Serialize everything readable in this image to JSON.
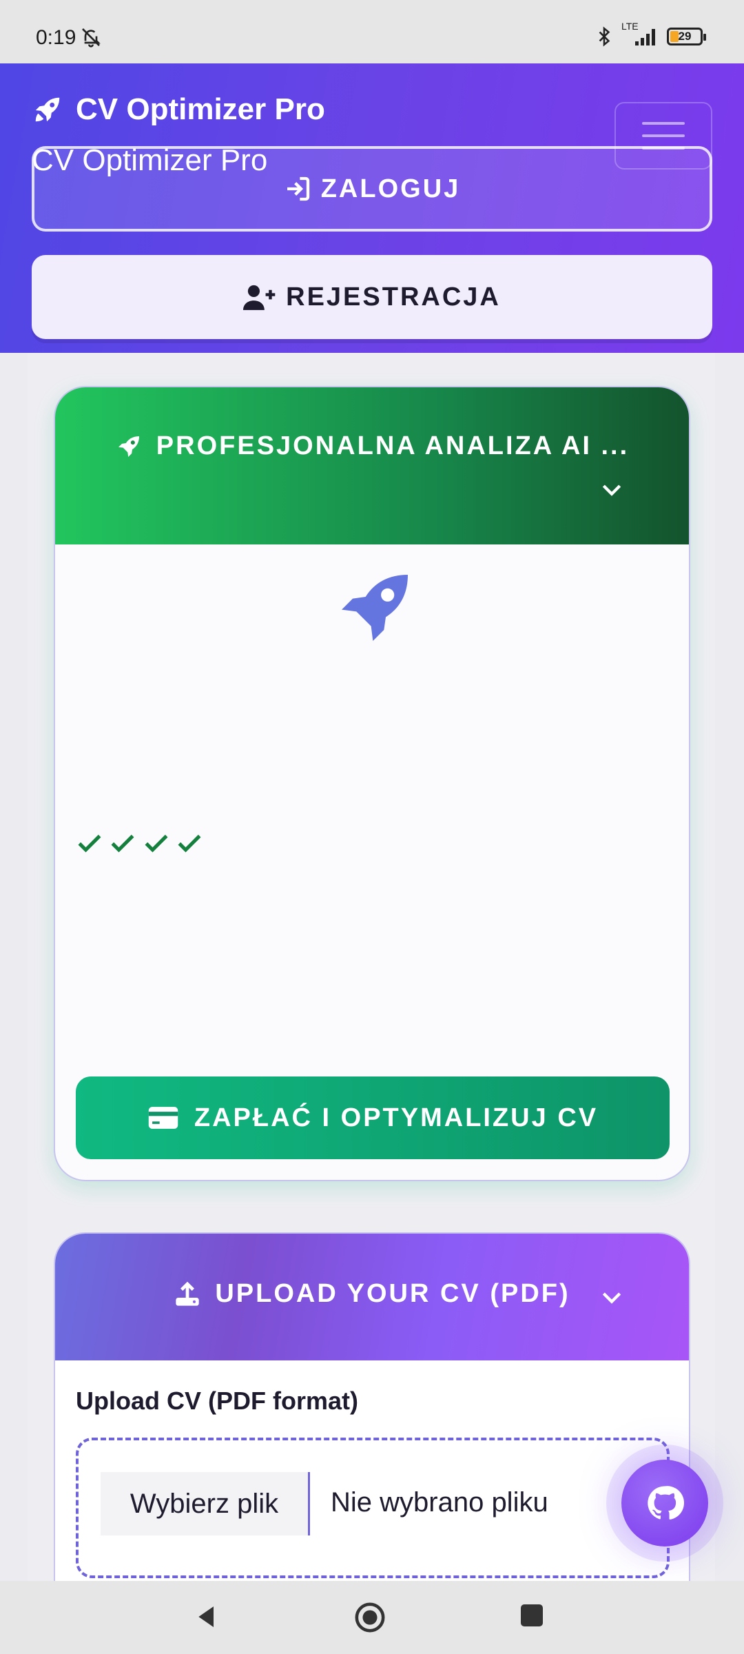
{
  "status_bar": {
    "time": "0:19",
    "network": "LTE",
    "battery": "29"
  },
  "header": {
    "brand": "CV Optimizer Pro",
    "brand_secondary": "CV Optimizer Pro",
    "login_label": "ZALOGUJ",
    "register_label": "REJESTRACJA"
  },
  "pro_card": {
    "title": "PROFESJONALNA ANALIZA AI ...",
    "pay_label": "ZAPŁAĆ I OPTYMALIZUJ CV"
  },
  "upload_card": {
    "title": "UPLOAD YOUR CV (PDF)",
    "field_label": "Upload CV (PDF format)",
    "choose_file_label": "Wybierz plik",
    "no_file_label": "Nie wybrano pliku"
  },
  "colors": {
    "header_gradient": [
      "#4f46e5",
      "#7c3aed"
    ],
    "pro_header_gradient": [
      "#22c55e",
      "#14532d"
    ],
    "pay_button": "#10b981",
    "upload_header_gradient": [
      "#6c6ee0",
      "#a855f7"
    ],
    "rocket_accent": "#6475e0"
  }
}
